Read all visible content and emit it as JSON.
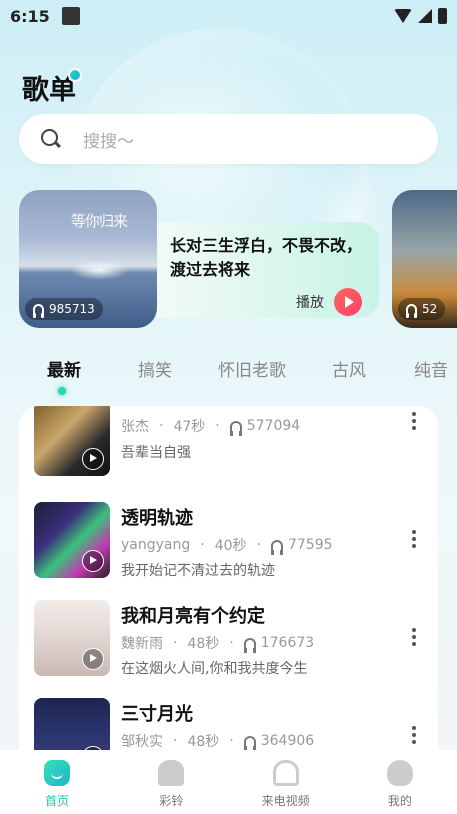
{
  "status_bar": {
    "time": "6:15"
  },
  "header": {
    "title": "歌单"
  },
  "search": {
    "placeholder": "搜搜～"
  },
  "banner": {
    "cover_art_text": "等你归来",
    "play_count": "985713",
    "text": "长对三生浮白，不畏不改，渡过去将来",
    "play_label": "播放",
    "next_play_count": "52"
  },
  "tabs": [
    {
      "label": "最新",
      "active": true
    },
    {
      "label": "搞笑",
      "active": false
    },
    {
      "label": "怀旧老歌",
      "active": false
    },
    {
      "label": "古风",
      "active": false
    },
    {
      "label": "纯音",
      "active": false
    }
  ],
  "songs": [
    {
      "title": "",
      "artist": "张杰",
      "duration": "47秒",
      "plays": "577094",
      "desc": "吾辈当自强"
    },
    {
      "title": "透明轨迹",
      "artist": "yangyang",
      "duration": "40秒",
      "plays": "77595",
      "desc": "我开始记不清过去的轨迹"
    },
    {
      "title": "我和月亮有个约定",
      "artist": "魏新雨",
      "duration": "48秒",
      "plays": "176673",
      "desc": "在这烟火人间,你和我共度今生"
    },
    {
      "title": "三寸月光",
      "artist": "邹秋实",
      "duration": "48秒",
      "plays": "364906",
      "desc": ""
    }
  ],
  "nav": [
    {
      "label": "首页",
      "icon": "home-icon",
      "active": true
    },
    {
      "label": "彩铃",
      "icon": "bell-icon",
      "active": false
    },
    {
      "label": "来电视频",
      "icon": "phone-icon",
      "active": false
    },
    {
      "label": "我的",
      "icon": "profile-icon",
      "active": false
    }
  ],
  "colors": {
    "accent": "#1fc6a5",
    "play_button": "#ff4a64"
  }
}
